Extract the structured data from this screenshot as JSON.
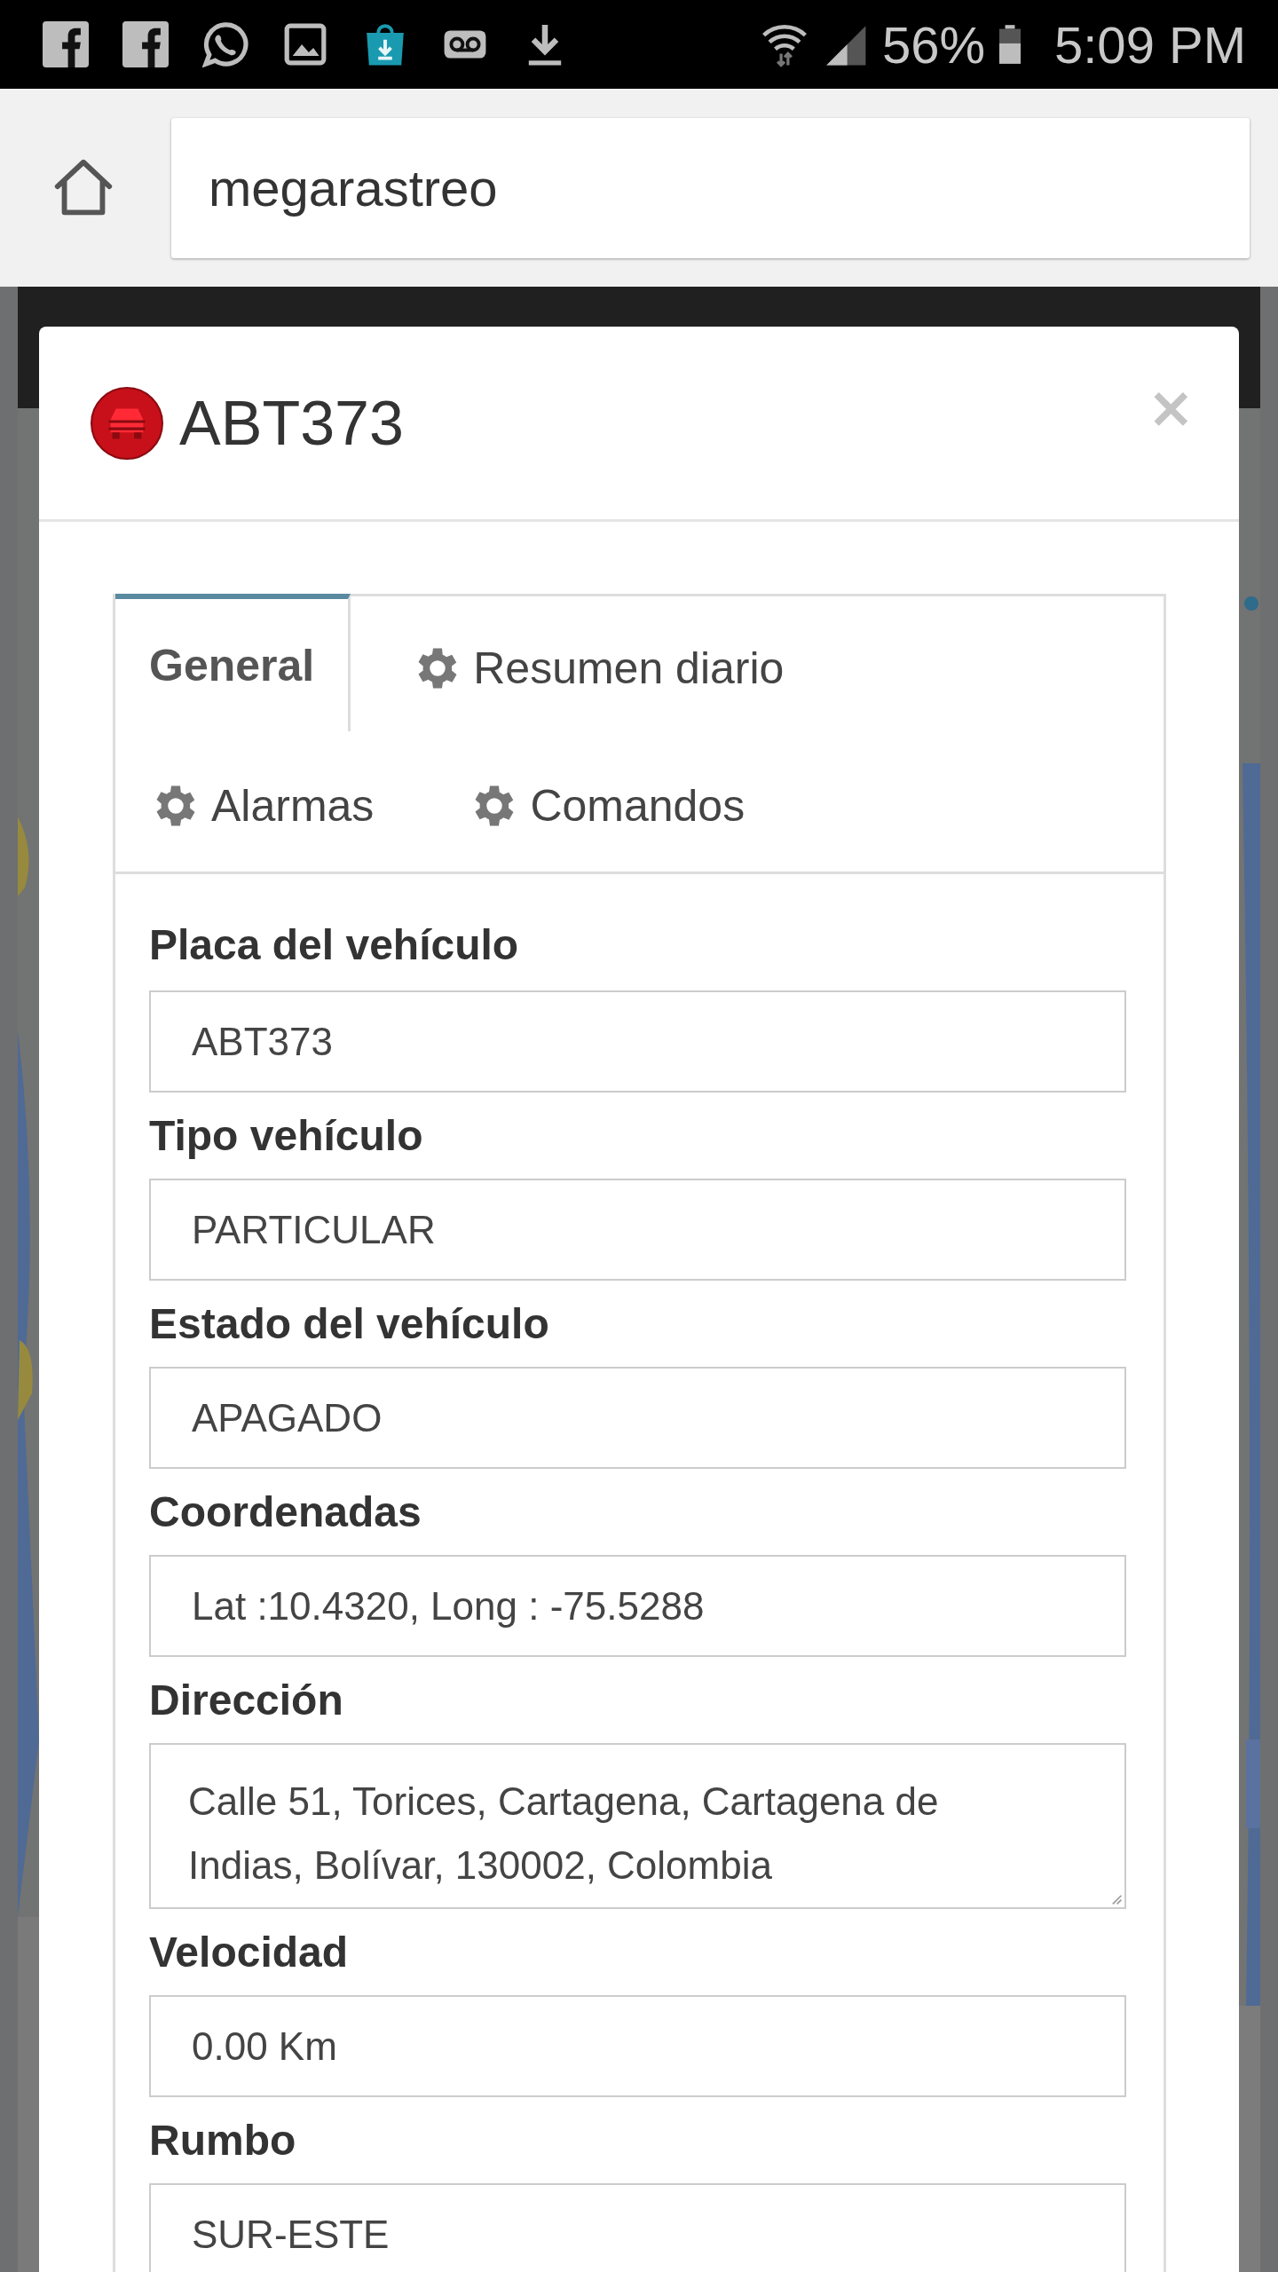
{
  "status_bar": {
    "battery": "56%",
    "time": "5:09 PM"
  },
  "browser": {
    "url": "megarastreo"
  },
  "dialog": {
    "title": "ABT373",
    "close": "×",
    "tabs": [
      {
        "label": "General",
        "selected": true,
        "icon": false
      },
      {
        "label": "Resumen diario",
        "selected": false,
        "icon": true
      },
      {
        "label": "Alarmas",
        "selected": false,
        "icon": true
      },
      {
        "label": "Comandos",
        "selected": false,
        "icon": true
      }
    ],
    "fields": [
      {
        "label": "Placa del vehículo",
        "value": "ABT373",
        "kind": "input"
      },
      {
        "label": "Tipo vehículo",
        "value": "PARTICULAR",
        "kind": "input"
      },
      {
        "label": "Estado del vehículo",
        "value": "APAGADO",
        "kind": "input"
      },
      {
        "label": "Coordenadas",
        "value": "Lat :10.4320, Long : -75.5288",
        "kind": "input"
      },
      {
        "label": "Dirección",
        "value": "Calle 51, Torices, Cartagena, Cartagena de Indias, Bolívar, 130002, Colombia",
        "kind": "textarea"
      },
      {
        "label": "Velocidad",
        "value": "0.00 Km",
        "kind": "input"
      },
      {
        "label": "Rumbo",
        "value": "SUR-ESTE",
        "kind": "input"
      }
    ]
  }
}
